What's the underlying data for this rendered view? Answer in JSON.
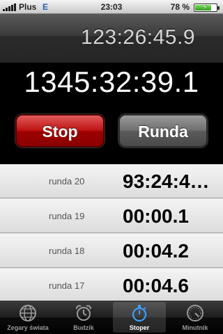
{
  "status_bar": {
    "carrier": "Plus",
    "network": "E",
    "time": "23:03",
    "battery_percent": "78 %",
    "battery_level": 0.78
  },
  "stopwatch": {
    "lap_time": "123:26:45.9",
    "total_time": "1345:32:39.1",
    "stop_label": "Stop",
    "lap_label": "Runda"
  },
  "laps": [
    {
      "label": "runda 20",
      "time": "93:24:4…"
    },
    {
      "label": "runda 19",
      "time": "00:00.1"
    },
    {
      "label": "runda 18",
      "time": "00:04.2"
    },
    {
      "label": "runda 17",
      "time": "00:04.6"
    }
  ],
  "tabs": [
    {
      "label": "Zegary świata",
      "icon": "globe-icon"
    },
    {
      "label": "Budzik",
      "icon": "alarm-clock-icon"
    },
    {
      "label": "Stoper",
      "icon": "stopwatch-icon",
      "active": true
    },
    {
      "label": "Minutnik",
      "icon": "timer-icon"
    }
  ],
  "colors": {
    "stop_button": "#c01414",
    "lap_button": "#707070",
    "tab_active_icon": "#3aa0ff"
  }
}
